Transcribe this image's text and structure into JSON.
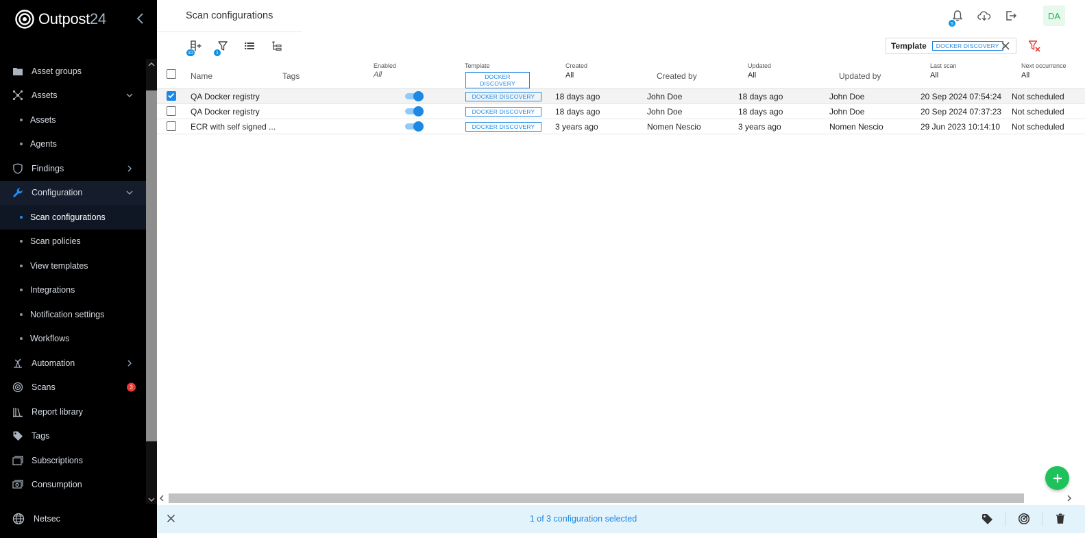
{
  "app": {
    "logo_text": "Outpost",
    "logo_num": "24"
  },
  "sidebar": {
    "items": [
      {
        "label": "Asset groups",
        "icon": "folder-icon",
        "type": "top"
      },
      {
        "label": "Assets",
        "icon": "network-icon",
        "type": "top",
        "chevron": "down"
      },
      {
        "label": "Assets",
        "type": "sub"
      },
      {
        "label": "Agents",
        "type": "sub"
      },
      {
        "label": "Findings",
        "icon": "shield-icon",
        "type": "top",
        "chevron": "right"
      },
      {
        "label": "Configuration",
        "icon": "wrench-icon",
        "type": "top",
        "chevron": "down",
        "active": true
      },
      {
        "label": "Scan configurations",
        "type": "sub",
        "active": true
      },
      {
        "label": "Scan policies",
        "type": "sub"
      },
      {
        "label": "View templates",
        "type": "sub"
      },
      {
        "label": "Integrations",
        "type": "sub"
      },
      {
        "label": "Notification settings",
        "type": "sub"
      },
      {
        "label": "Workflows",
        "type": "sub"
      },
      {
        "label": "Automation",
        "icon": "automation-icon",
        "type": "top",
        "chevron": "right"
      },
      {
        "label": "Scans",
        "icon": "radar-icon",
        "type": "top",
        "badge": "3"
      },
      {
        "label": "Report library",
        "icon": "library-icon",
        "type": "top"
      },
      {
        "label": "Tags",
        "icon": "tag-icon",
        "type": "top"
      },
      {
        "label": "Subscriptions",
        "icon": "subscription-icon",
        "type": "top"
      },
      {
        "label": "Consumption",
        "icon": "consumption-icon",
        "type": "top"
      }
    ],
    "workspace": "Netsec"
  },
  "header": {
    "title": "Scan configurations",
    "notifications_count": "5",
    "avatar": "DA"
  },
  "toolbar": {
    "columns_badge": "10",
    "filter_badge": "1",
    "active_filter": {
      "label": "Template",
      "value": "DOCKER DISCOVERY"
    }
  },
  "table": {
    "columns": {
      "name": "Name",
      "tags": "Tags",
      "enabled": {
        "label": "Enabled",
        "filter": "All"
      },
      "template": {
        "label": "Template",
        "filter": "DOCKER DISCOVERY"
      },
      "created": {
        "label": "Created",
        "filter": "All"
      },
      "created_by": "Created by",
      "updated": {
        "label": "Updated",
        "filter": "All"
      },
      "updated_by": "Updated by",
      "last_scan": {
        "label": "Last scan",
        "filter": "All"
      },
      "next_occurrence": {
        "label": "Next occurrence",
        "filter": "All"
      }
    },
    "rows": [
      {
        "selected": true,
        "name": "QA Docker registry",
        "tags": "",
        "enabled": true,
        "template": "DOCKER DISCOVERY",
        "created": "18 days ago",
        "created_by": "John Doe",
        "updated": "18 days ago",
        "updated_by": "John Doe",
        "last_scan": "20 Sep 2024 07:54:24",
        "next": "Not scheduled"
      },
      {
        "selected": false,
        "name": "QA Docker registry",
        "tags": "",
        "enabled": true,
        "template": "DOCKER DISCOVERY",
        "created": "18 days ago",
        "created_by": "John Doe",
        "updated": "18 days ago",
        "updated_by": "John Doe",
        "last_scan": "20 Sep 2024 07:37:23",
        "next": "Not scheduled"
      },
      {
        "selected": false,
        "name": "ECR with self signed ...",
        "tags": "",
        "enabled": true,
        "template": "DOCKER DISCOVERY",
        "created": "3 years ago",
        "created_by": "Nomen Nescio",
        "updated": "3 years ago",
        "updated_by": "Nomen Nescio",
        "last_scan": "29 Jun 2023 10:14:10",
        "next": "Not scheduled"
      }
    ]
  },
  "selection_bar": {
    "text": "1 of 3 configuration selected"
  },
  "colors": {
    "accent": "#1e88e5",
    "add_button": "#1fc25a",
    "badge_red": "#e53935"
  }
}
